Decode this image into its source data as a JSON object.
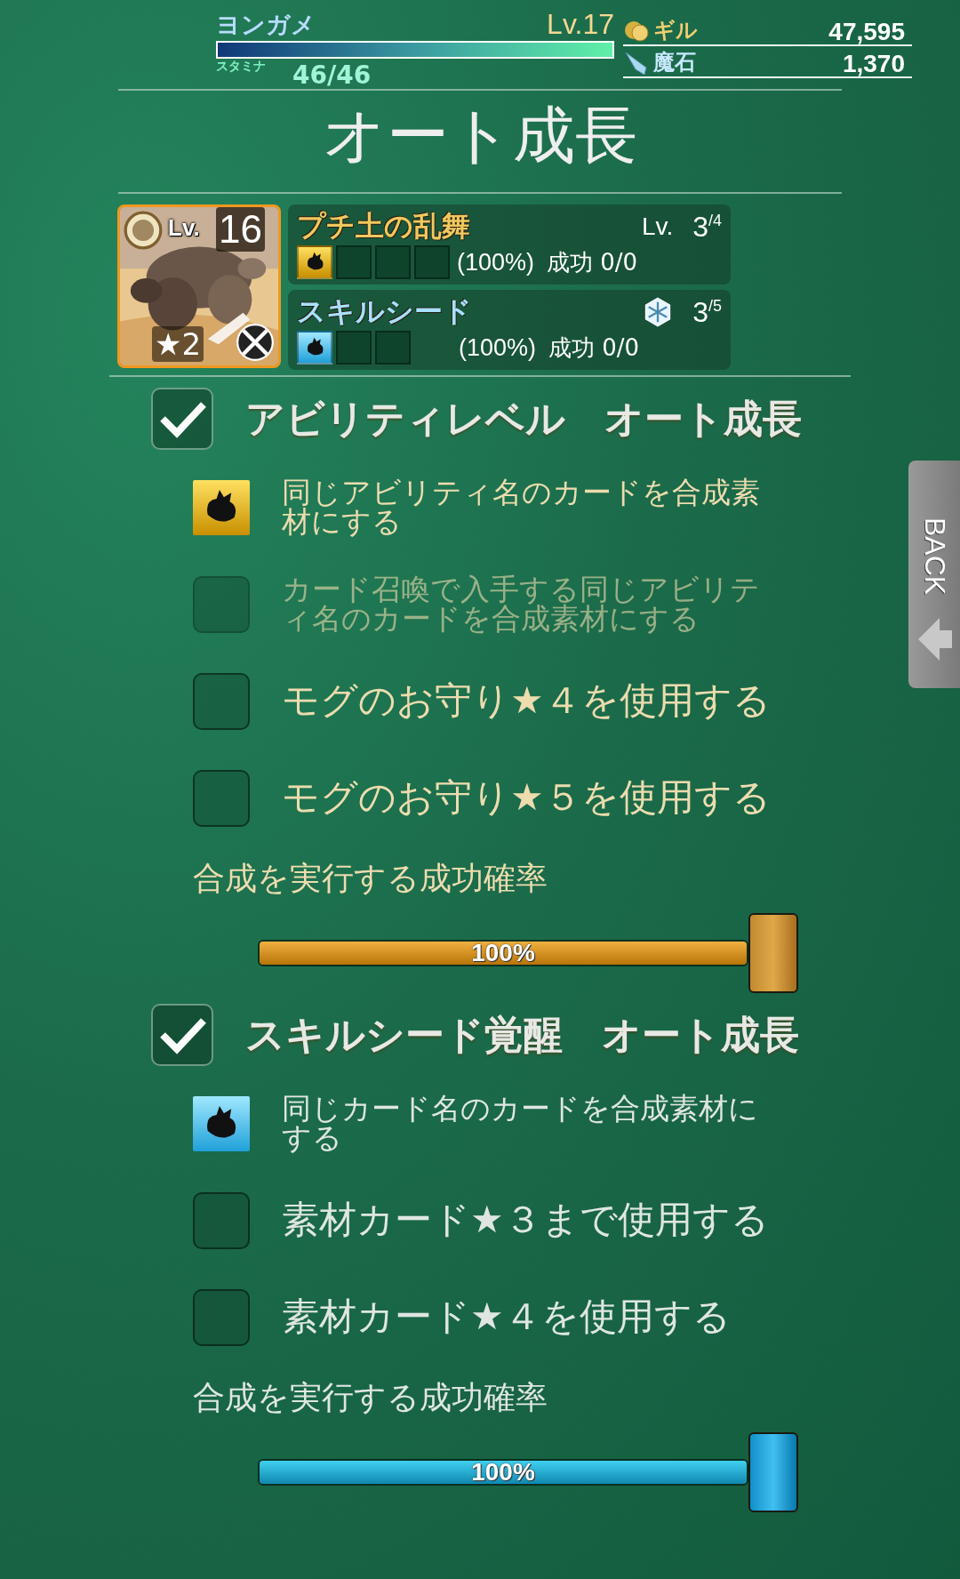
{
  "header": {
    "player_name": "ヨンガメ",
    "level": "Lv.17",
    "stamina_label": "スタミナ",
    "stamina": "46/46",
    "stamina_bar": {
      "level": 1
    },
    "gil_label": "ギル",
    "gil": "47,595",
    "magicite_label": "魔石",
    "magicite": "1,370"
  },
  "title": "オート成長",
  "card": {
    "level_label": "Lv.",
    "level": "16",
    "rarity": "★2"
  },
  "skills": [
    {
      "kind": "ability",
      "name": "プチ土の乱舞",
      "level_label": "Lv.",
      "value": "3$^{/4}$",
      "slots": [
        {
          "filled": true
        },
        {
          "filled": false
        },
        {
          "filled": false
        },
        {
          "filled": false
        }
      ],
      "rate": "(100%)",
      "success": "成功 0/0"
    },
    {
      "kind": "seed",
      "name": "スキルシード",
      "value": "3$^{/5}$",
      "slots": [
        {
          "filled": true
        },
        {
          "filled": false
        },
        {
          "filled": false
        }
      ],
      "rate": "(100%)",
      "success": "成功 0/0"
    }
  ],
  "sections": [
    {
      "kind": "ability",
      "title": "アビリティレベル　オート成長",
      "checked": true,
      "options": [
        {
          "kind": "fixed",
          "text": "同じアビリティ名のカードを合成素材にする"
        },
        {
          "kind": "checkbox",
          "text": "カード召喚で入手する同じアビリティ名のカードを合成素材にする",
          "checked": false,
          "disabled": true
        },
        {
          "kind": "checkbox",
          "text": "モグのお守り★４を使用する",
          "checked": false,
          "disabled": false
        },
        {
          "kind": "checkbox",
          "text": "モグのお守り★５を使用する",
          "checked": false,
          "disabled": false
        }
      ],
      "slider_label": "合成を実行する成功確率",
      "slider": {
        "level": 1,
        "reading": "100%"
      }
    },
    {
      "kind": "seed",
      "title": "スキルシード覚醒　オート成長",
      "checked": true,
      "options": [
        {
          "kind": "fixed",
          "text": "同じカード名のカードを合成素材にする"
        },
        {
          "kind": "checkbox",
          "text": "素材カード★３まで使用する",
          "checked": false,
          "disabled": false
        },
        {
          "kind": "checkbox",
          "text": "素材カード★４を使用する",
          "checked": false,
          "disabled": false
        }
      ],
      "slider_label": "合成を実行する成功確率",
      "slider": {
        "level": 1,
        "reading": "100%"
      }
    }
  ],
  "back_button": {
    "label": "BACK"
  }
}
